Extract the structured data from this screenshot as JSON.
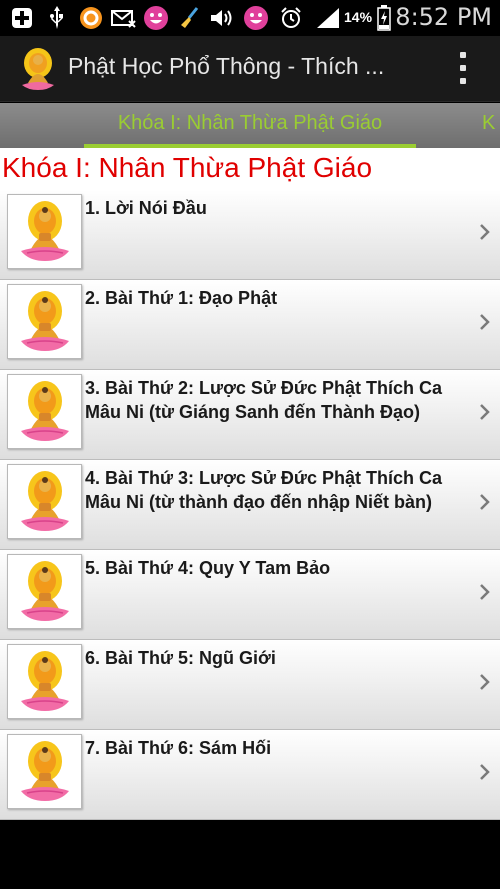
{
  "status_bar": {
    "battery_percent": "14%",
    "time": "8:52 PM",
    "icons": [
      "add-icon",
      "usb-icon",
      "circle-app-icon",
      "email-icon",
      "smiley-icon",
      "broom-icon",
      "volume-icon",
      "smiley-icon",
      "alarm-icon",
      "signal-icon",
      "battery-icon"
    ]
  },
  "action_bar": {
    "title": "Phật Học Phổ Thông - Thích ...",
    "logo_icon": "buddha-icon",
    "overflow_icon": "overflow-menu-icon"
  },
  "tabs": {
    "active_label": "Khóa I: Nhân Thừa Phật Giáo",
    "next_label_partial": "K",
    "accent_color": "#9acd32"
  },
  "content": {
    "section_title": "Khóa I: Nhân Thừa Phật Giáo",
    "section_title_color": "#e00000",
    "items": [
      {
        "label": "1. Lời Nói Đầu"
      },
      {
        "label": "2. Bài Thứ 1: Đạo Phật"
      },
      {
        "label": "3. Bài Thứ 2: Lược Sử Đức Phật Thích Ca\nMâu Ni (từ Giáng Sanh đến Thành Đạo)"
      },
      {
        "label": "4. Bài Thứ 3: Lược Sử Đức Phật Thích Ca\nMâu Ni  (từ thành đạo đến nhập Niết bàn)"
      },
      {
        "label": "5. Bài Thứ 4: Quy Y Tam Bảo"
      },
      {
        "label": "6. Bài Thứ 5: Ngũ Giới"
      },
      {
        "label": "7. Bài Thứ 6: Sám Hối"
      }
    ]
  }
}
